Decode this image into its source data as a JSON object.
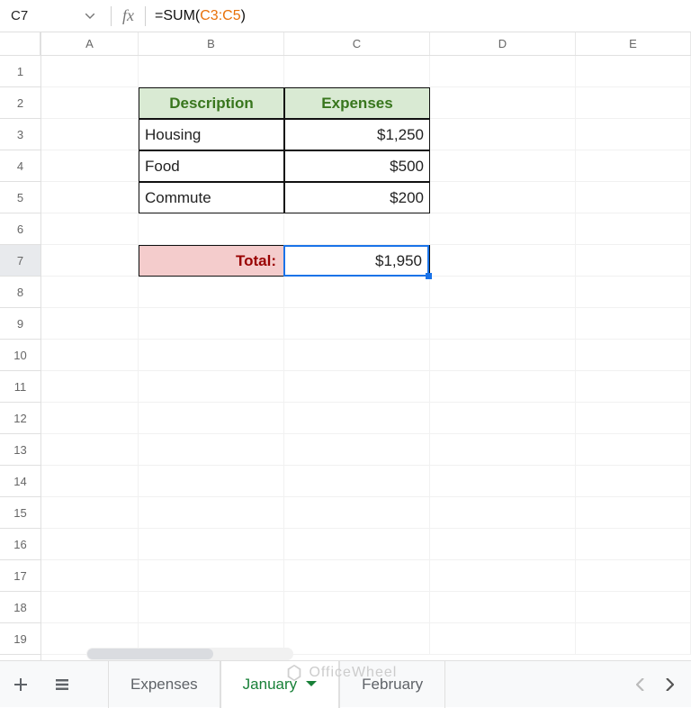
{
  "nameBox": "C7",
  "formula": {
    "prefix": "=SUM(",
    "ref": "C3:C5",
    "suffix": ")"
  },
  "columns": [
    "A",
    "B",
    "C",
    "D",
    "E"
  ],
  "rows": [
    "1",
    "2",
    "3",
    "4",
    "5",
    "6",
    "7",
    "8",
    "9",
    "10",
    "11",
    "12",
    "13",
    "14",
    "15",
    "16",
    "17",
    "18",
    "19"
  ],
  "table": {
    "headers": {
      "desc": "Description",
      "exp": "Expenses"
    },
    "rows": [
      {
        "desc": "Housing",
        "exp": "$1,250"
      },
      {
        "desc": "Food",
        "exp": "$500"
      },
      {
        "desc": "Commute",
        "exp": "$200"
      }
    ],
    "totalLabel": "Total:",
    "totalValue": "$1,950"
  },
  "tabs": {
    "t1": "Expenses",
    "t2": "January",
    "t3": "February"
  },
  "watermark": "OfficeWheel"
}
